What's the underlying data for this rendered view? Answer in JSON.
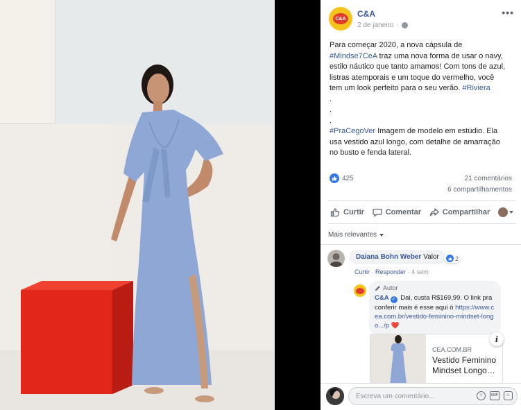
{
  "post": {
    "page_name": "C&A",
    "avatar_text": "C&A",
    "date": "2 de janeiro",
    "more": "•••",
    "text": {
      "l1": "Para começar 2020, a nova cápsula de",
      "hashtag1": "#Mindse7CeA",
      "l2": " traz uma nova forma de usar o navy,",
      "l3": "estilo náutico que tanto amamos! Com tons de azul,",
      "l4": "listras atemporais e um toque do vermelho, você",
      "l5": "tem um look perfeito para o seu verão. ",
      "hashtag2": "#Riviera",
      "dot": ".",
      "hashtag3": "#PraCegoVer",
      "l6": " Imagem de modelo em estúdio. Ela",
      "l7": "usa vestido azul longo, com detalhe de amarração",
      "l8": "no busto e fenda lateral."
    },
    "reactions_count": "425",
    "comments_count": "21 comentários",
    "shares_count": "6 compartilhamentos"
  },
  "actions": {
    "like": "Curtir",
    "comment": "Comentar",
    "share": "Compartilhar"
  },
  "sort": {
    "label": "Mais relevantes"
  },
  "comment": {
    "author": "Daiana Bohn Weber",
    "text": "Valor",
    "reaction_count": "2",
    "like": "Curtir",
    "reply": "Responder",
    "time": "4 sem"
  },
  "reply": {
    "author_tag": "Autor",
    "author": "C&A",
    "text": "Dai, custa R$169,99. O link pra conferir mais é esse aqui ó",
    "link": "https://www.cea.com.br/vestido-feminino-mindset-longo.../p",
    "heart": "❤️"
  },
  "preview": {
    "domain": "CEA.COM.BR",
    "title": "Vestido Feminino Mindset Longo…",
    "info": "i"
  },
  "composer": {
    "placeholder": "Escreva um comentário..."
  },
  "colors": {
    "dress": "#8ea7d4",
    "cube": "#e8261c",
    "link": "#385898",
    "brand_yellow": "#f6c21c"
  }
}
